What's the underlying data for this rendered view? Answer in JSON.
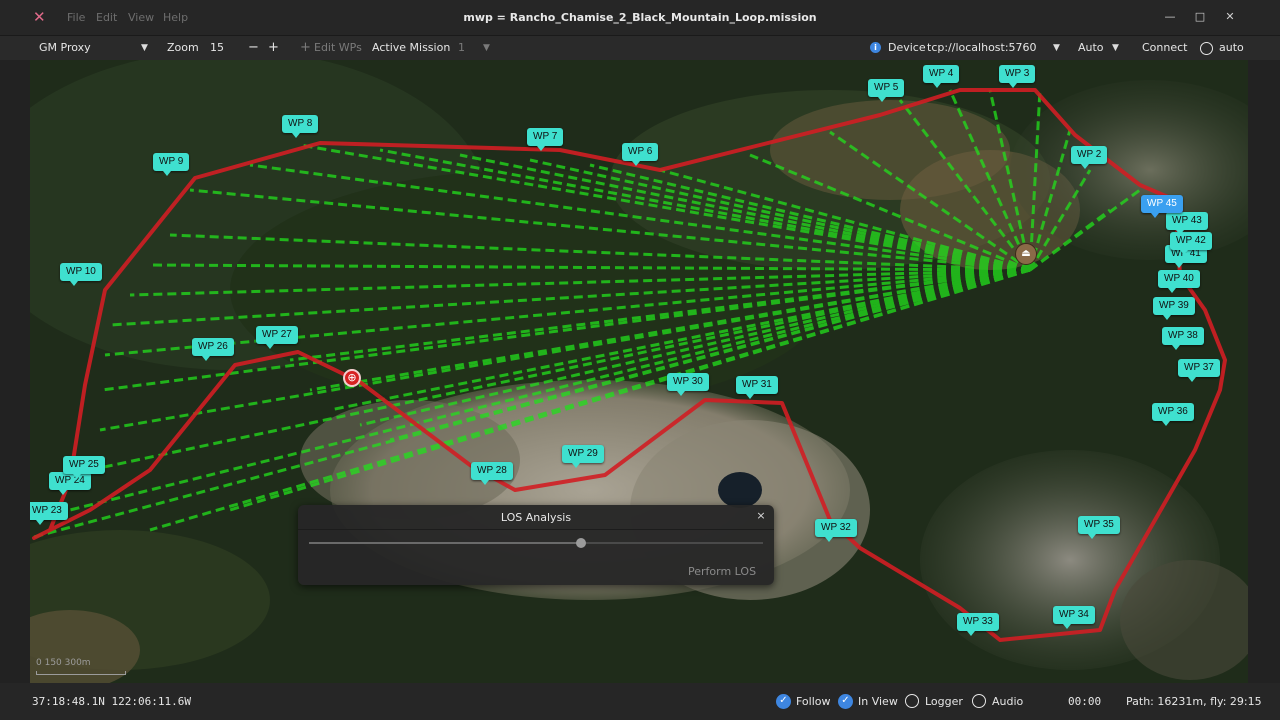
{
  "window": {
    "title": "mwp = Rancho_Chamise_2_Black_Mountain_Loop.mission",
    "menu": [
      "File",
      "Edit",
      "View",
      "Help"
    ],
    "icon": "mwp-logo-icon"
  },
  "toolbar": {
    "map_source": "GM Proxy",
    "zoom_label": "Zoom",
    "zoom_value": "15",
    "zoom_out": "−",
    "zoom_in": "+",
    "edit_wps": "Edit WPs",
    "active_mission_label": "Active Mission",
    "active_mission_value": "1",
    "device_label": "Device",
    "device_value": "tcp://localhost:5760",
    "protocol": "Auto",
    "connect": "Connect",
    "auto_label": "auto"
  },
  "map": {
    "scale_label": "0    150    300m",
    "home_icon": "home-icon",
    "los_point_icon": "crosshair-icon",
    "waypoints": [
      {
        "label": "WP 2"
      },
      {
        "label": "WP 3"
      },
      {
        "label": "WP 4"
      },
      {
        "label": "WP 5"
      },
      {
        "label": "WP 6"
      },
      {
        "label": "WP 7"
      },
      {
        "label": "WP 8"
      },
      {
        "label": "WP 9"
      },
      {
        "label": "WP 10"
      },
      {
        "label": "WP 23"
      },
      {
        "label": "WP 24"
      },
      {
        "label": "WP 25"
      },
      {
        "label": "WP 26"
      },
      {
        "label": "WP 27"
      },
      {
        "label": "WP 28"
      },
      {
        "label": "WP 29"
      },
      {
        "label": "WP 30"
      },
      {
        "label": "WP 31"
      },
      {
        "label": "WP 32"
      },
      {
        "label": "WP 33"
      },
      {
        "label": "WP 34"
      },
      {
        "label": "WP 35"
      },
      {
        "label": "WP 36"
      },
      {
        "label": "WP 37"
      },
      {
        "label": "WP 38"
      },
      {
        "label": "WP 39"
      },
      {
        "label": "WP 40"
      },
      {
        "label": "WP 41"
      },
      {
        "label": "WP 42"
      },
      {
        "label": "WP 43"
      },
      {
        "label": "WP 45"
      }
    ],
    "path_color": "#d01e24",
    "los_color": "#22e01c"
  },
  "los_dialog": {
    "title": "LOS Analysis",
    "close": "×",
    "slider_value": 0.6,
    "perform_button": "Perform LOS"
  },
  "statusbar": {
    "coordinates": "37:18:48.1N 122:06:11.6W",
    "follow": "Follow",
    "in_view": "In View",
    "logger": "Logger",
    "audio": "Audio",
    "timer": "00:00",
    "path_info": "Path: 16231m, fly: 29:15"
  }
}
